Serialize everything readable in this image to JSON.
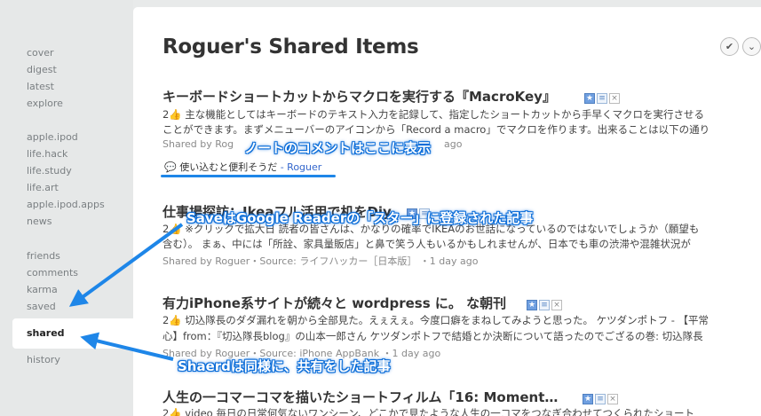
{
  "sidebar": {
    "groups": [
      [
        "cover",
        "digest",
        "latest",
        "explore"
      ],
      [
        "apple.ipod",
        "life.hack",
        "life.study",
        "life.art",
        "apple.ipod.apps",
        "news"
      ],
      [
        "friends",
        "comments",
        "karma",
        "saved",
        "shared",
        "history"
      ]
    ],
    "active": "shared"
  },
  "page": {
    "title": "Roguer's Shared Items",
    "check_icon": "checkmark-icon",
    "chevron_icon": "chevron-down-icon"
  },
  "items": [
    {
      "title": "キーボードショートカットからマクロを実行する『MacroKey』",
      "line1": "2👍 主な機能としてはキーボードのテキスト入力を記録して、指定したショートカットから手早くマクロを実行させる",
      "line2": "ことができます。まずメニューバーのアイコンから「Record a macro」でマクロを作ります。出来ることは以下の通り",
      "meta": "Shared by Rog",
      "meta_tail": "ago",
      "comment": "使い込むと便利そうだ",
      "comment_author": "- Roguer"
    },
    {
      "title": "仕事場探訪：Ikeaフル活用で机をDiy",
      "line1": "2👍 ※クリックで拡大日 読者の皆さんは、かなりの確率でIKEAのお世話になっているのではないでしょうか（願望も",
      "line2": "含む）。 まぁ、中には「所詮、家具量販店」と鼻で笑う人もいるかもしれませんが、日本でも車の渋滞や混雑状況が",
      "meta": "Shared by Roguer・Source: ライフハッカー［日本版］ ・1 day ago"
    },
    {
      "title": "有力iPhone系サイトが続々と wordpress に。 な朝刊",
      "line1": "2👍 切込隊長のダダ漏れを朝から全部見た。えぇえぇ。今度口癖をまねしてみようと思った。 ケツダンポトフ - 【平常",
      "line2": "心】from：『切込隊長blog』の山本一郎さん ケツダンポトフで結婚とか決断について語ったのでござるの巻: 切込隊長",
      "meta": "Shared by Roguer・Source: iPhone AppBank ・1 day ago"
    },
    {
      "title": "人生の一コマーコマを描いたショートフィルム「16: Moment…",
      "line1": "2👍 video 毎日の日常何気ないワンシーン、どこかで見たような人生の一コマをつなぎ合わせてつくられたショート"
    }
  ],
  "annotations": {
    "comment_note": "ノートのコメントはここに表示",
    "saved_note": "SaveはGoogle Readerの「スター」に登録された記事",
    "shared_note": "Shaerdは同様に、共有をした記事"
  },
  "colors": {
    "accent": "#1e86e8",
    "link": "#3366cc"
  }
}
